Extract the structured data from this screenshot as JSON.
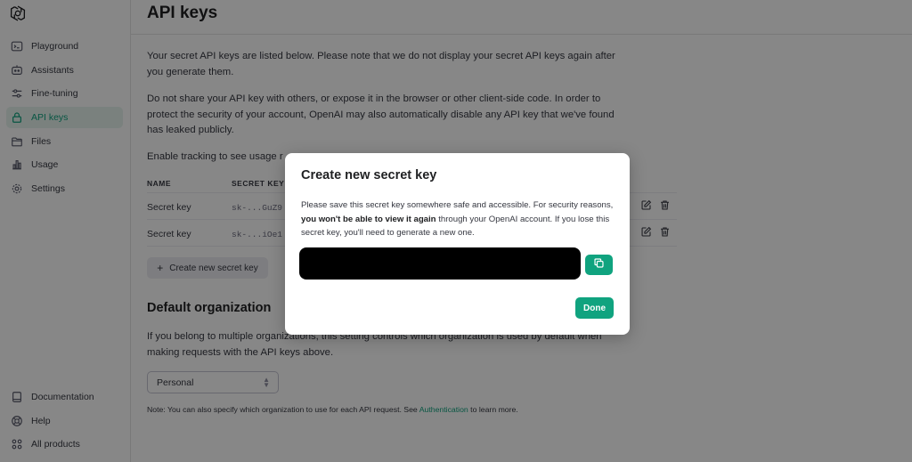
{
  "sidebar": {
    "items": [
      {
        "label": "Playground",
        "icon": "terminal-icon"
      },
      {
        "label": "Assistants",
        "icon": "robot-icon"
      },
      {
        "label": "Fine-tuning",
        "icon": "sliders-icon"
      },
      {
        "label": "API keys",
        "icon": "lock-icon",
        "active": true
      },
      {
        "label": "Files",
        "icon": "folder-icon"
      },
      {
        "label": "Usage",
        "icon": "bar-chart-icon"
      },
      {
        "label": "Settings",
        "icon": "gear-icon"
      }
    ],
    "bottom_items": [
      {
        "label": "Documentation",
        "icon": "book-icon"
      },
      {
        "label": "Help",
        "icon": "lifebuoy-icon"
      },
      {
        "label": "All products",
        "icon": "grid-icon"
      }
    ]
  },
  "main": {
    "title": "API keys",
    "p1": "Your secret API keys are listed below. Please note that we do not display your secret API keys again after you generate them.",
    "p2": "Do not share your API key with others, or expose it in the browser or other client-side code. In order to protect the security of your account, OpenAI may also automatically disable any API key that we've found has leaked publicly.",
    "p3": "Enable tracking to see usage r",
    "table": {
      "headers": [
        "NAME",
        "SECRET KEY"
      ],
      "rows": [
        {
          "name": "Secret key",
          "key": "sk-...GuZ9"
        },
        {
          "name": "Secret key",
          "key": "sk-...iOe1"
        }
      ]
    },
    "create_button": "Create new secret key",
    "default_org_heading": "Default organization",
    "p4": "If you belong to multiple organizations, this setting controls which organization is used by default when making requests with the API keys above.",
    "org_select_value": "Personal",
    "note_prefix": "Note: You can also specify which organization to use for each API request. See ",
    "note_link": "Authentication",
    "note_suffix": " to learn more."
  },
  "modal": {
    "title": "Create new secret key",
    "text_1": "Please save this secret key somewhere safe and accessible. For security reasons, ",
    "text_bold": "you won't be able to view it again",
    "text_2": " through your OpenAI account. If you lose this secret key, you'll need to generate a new one.",
    "done_label": "Done"
  },
  "colors": {
    "accent": "#10a37f",
    "overlay": "rgba(0,0,0,0.47)"
  }
}
